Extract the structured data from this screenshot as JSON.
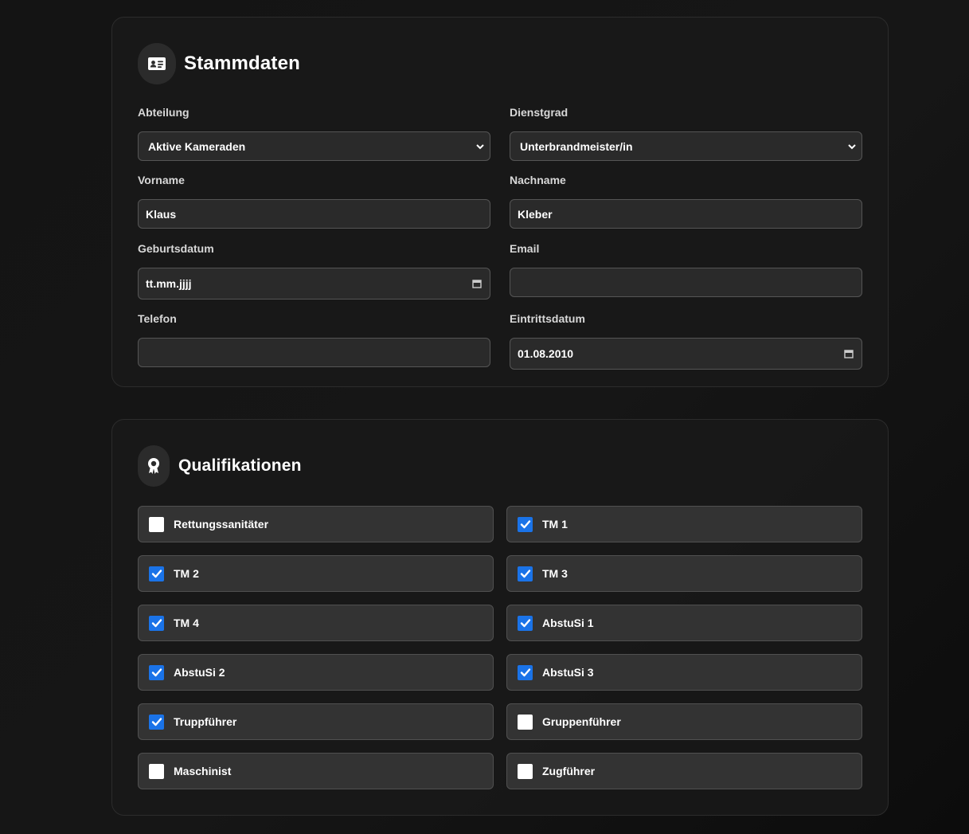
{
  "stammdaten": {
    "title": "Stammdaten",
    "icon": "id-card-icon",
    "abteilung": {
      "label": "Abteilung",
      "value": "Aktive Kameraden"
    },
    "dienstgrad": {
      "label": "Dienstgrad",
      "value": "Unterbrandmeister/in"
    },
    "vorname": {
      "label": "Vorname",
      "value": "Klaus"
    },
    "nachname": {
      "label": "Nachname",
      "value": "Kleber"
    },
    "geburtsdatum": {
      "label": "Geburtsdatum",
      "value": "tt.mm.jjjj"
    },
    "email": {
      "label": "Email",
      "value": ""
    },
    "telefon": {
      "label": "Telefon",
      "value": ""
    },
    "eintrittsdatum": {
      "label": "Eintrittsdatum",
      "value": "01.08.2010"
    }
  },
  "qualifikationen": {
    "title": "Qualifikationen",
    "icon": "award-icon",
    "items": [
      {
        "label": "Rettungssanitäter",
        "checked": false
      },
      {
        "label": "TM 1",
        "checked": true
      },
      {
        "label": "TM 2",
        "checked": true
      },
      {
        "label": "TM 3",
        "checked": true
      },
      {
        "label": "TM 4",
        "checked": true
      },
      {
        "label": "AbstuSi 1",
        "checked": true
      },
      {
        "label": "AbstuSi 2",
        "checked": true
      },
      {
        "label": "AbstuSi 3",
        "checked": true
      },
      {
        "label": "Truppführer",
        "checked": true
      },
      {
        "label": "Gruppenführer",
        "checked": false
      },
      {
        "label": "Maschinist",
        "checked": false
      },
      {
        "label": "Zugführer",
        "checked": false
      }
    ]
  },
  "colors": {
    "accent": "#1a73e8",
    "background": "#141414",
    "card": "#181818"
  }
}
